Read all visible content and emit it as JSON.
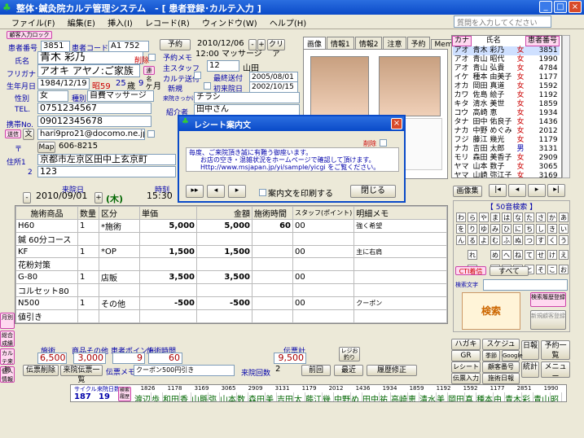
{
  "window": {
    "title": "整体･鍼灸院カルテ管理システム　- [ 患者登録･カルテ入力 ]"
  },
  "menu": [
    "ファイル(F)",
    "編集(E)",
    "挿入(I)",
    "レコード(R)",
    "ウィンドウ(W)",
    "ヘルプ(H)"
  ],
  "search": {
    "placeholder": "質問を入力してください"
  },
  "patient": {
    "badge": "顧客入力ロック",
    "number_label": "患者番号",
    "number": "3851",
    "code_label": "患者コード",
    "code": "A1 752",
    "reserve_btn": "予約",
    "date": "2010/12/06",
    "clear_btn": "クリア",
    "name_label": "氏名",
    "name": "青木 彩乃",
    "delete_label": "削除",
    "furigana_label": "フリガナ",
    "furigana": "アオキ アヤノ:ご家族",
    "link_btn": "連名",
    "birth_label": "生年月日",
    "birth": "1984/12/19",
    "era": "昭59",
    "age": "25",
    "age_unit": "歳",
    "months": "9",
    "months_unit": "ヶ月",
    "sex_label": "性別",
    "sex": "女",
    "type_label": "種別",
    "type": "自費マッサージ",
    "tel_label": "TEL.",
    "tel": "0751234567",
    "mobile_label": "携帯No.",
    "mobile": "09012345678",
    "mail_label": "文",
    "mail": "hari9pro21@docomo.ne.jp",
    "map_btn": "Map",
    "zip": "606-8215",
    "addr_label": "住所1",
    "addr1": "京都市左京区田中上玄京町",
    "addr2_label": "2",
    "addr2": "123",
    "memo_label": "予約メモ",
    "memo": "12:00 マッサージ",
    "staff_label": "主スタッフ",
    "staff_no": "12",
    "staff": "山田",
    "card_label": "カルテ送付",
    "last_visit_label": "最終送付",
    "last_visit": "2005/08/01",
    "new_label": "新規",
    "first_visit_label": "初来院日",
    "first_visit": "2002/10/15",
    "route_label": "来院きっかけ",
    "route": "チラシ",
    "intro_label": "紹介者",
    "intro": "田中さん"
  },
  "tabs": [
    "画像",
    "情報1",
    "情報2",
    "注意",
    "予約",
    "Memo"
  ],
  "patient_list": {
    "headers": [
      "カナ",
      "氏名",
      "",
      "患者番号"
    ],
    "rows": [
      [
        "アオ",
        "青木 彩乃",
        "女",
        "3851"
      ],
      [
        "アオ",
        "青山 昭代",
        "女",
        "1990"
      ],
      [
        "アオ",
        "青山 弘貴",
        "女",
        "4784"
      ],
      [
        "イケ",
        "種本 由美子",
        "女",
        "1177"
      ],
      [
        "オカ",
        "岡田 真道",
        "女",
        "1592"
      ],
      [
        "カワ",
        "佐島 絵子",
        "女",
        "1192"
      ],
      [
        "キタ",
        "清水 美世",
        "女",
        "1859"
      ],
      [
        "コウ",
        "高崎 恵",
        "女",
        "1934"
      ],
      [
        "タナ",
        "田中 佑良子",
        "女",
        "1436"
      ],
      [
        "ナカ",
        "中野 めぐみ",
        "女",
        "2012"
      ],
      [
        "フジ",
        "藤江 幾光",
        "女",
        "1179"
      ],
      [
        "ナカ",
        "吉田 太郎",
        "男",
        "3131"
      ],
      [
        "モリ",
        "森田 美香子",
        "女",
        "2909"
      ],
      [
        "ヤマ",
        "山本 数子",
        "女",
        "3065"
      ],
      [
        "ヤマ",
        "山崎 弥江子",
        "女",
        "3169"
      ],
      [
        "ワタ",
        "渡辺 みまる",
        "女",
        "1826"
      ]
    ]
  },
  "dialog": {
    "title": "レシート案内文",
    "delete_label": "削除",
    "line1": "毎度、ご来院頂き誠に有難う御座います。",
    "line2": "お店の空き・混雑状況をホームページで確認して頂けます。",
    "line3": "Http://www.msjapan.jp/yi/sample/yicgi  をご覧ください。",
    "print_label": "案内文を印刷する",
    "close_btn": "閉じる"
  },
  "visit": {
    "date_label": "来院日",
    "date": "2010/09/01",
    "weekday": "(木)",
    "time_label": "時刻",
    "time": "15:30",
    "headers": [
      "施術商品",
      "数量",
      "区分",
      "単価",
      "金額",
      "施術時間",
      "スタッフ(ポイント)",
      "明細メモ"
    ],
    "rows": [
      [
        "H60",
        "1",
        "*施術",
        "5,000",
        "5,000",
        "60",
        "00",
        "強く希望"
      ],
      [
        "鍼 60分コース",
        "",
        "",
        "",
        "",
        "",
        "",
        ""
      ],
      [
        "KF",
        "1",
        "*OP",
        "1,500",
        "1,500",
        "",
        "00",
        "主に右肩"
      ],
      [
        "花粉対策",
        "",
        "",
        "",
        "",
        "",
        "",
        ""
      ],
      [
        "G-80",
        "1",
        "店販",
        "3,500",
        "3,500",
        "",
        "00",
        ""
      ],
      [
        "コルセット80",
        "",
        "",
        "",
        "",
        "",
        "",
        ""
      ],
      [
        "N500",
        "1",
        "その他",
        "-500",
        "-500",
        "",
        "00",
        "クーポン"
      ],
      [
        "値引き",
        "",
        "",
        "",
        "",
        "",
        "",
        ""
      ]
    ]
  },
  "totals": {
    "labels": [
      "施術",
      "商品その他",
      "患者ポイント",
      "施術時間"
    ],
    "values": [
      "6,500",
      "3,000",
      "9",
      "60"
    ],
    "receipt_label": "伝票計",
    "receipt": "9,500",
    "count_label": "来院回数",
    "count": "2",
    "prev": "前回",
    "latest": "最近",
    "history": "履歴修正",
    "delete_btn": "伝票削除",
    "list_btn": "来院伝票一覧",
    "memo_label": "伝票メモ",
    "memo": "クーポン500円引き",
    "reg_btn": "レジお釣り"
  },
  "kana_panel": {
    "title": "【 50音検索 】",
    "kana": [
      "わ",
      "ら",
      "や",
      "ま",
      "は",
      "な",
      "た",
      "さ",
      "か",
      "あ",
      "を",
      "り",
      "ゆ",
      "み",
      "ひ",
      "に",
      "ち",
      "し",
      "き",
      "い",
      "ん",
      "る",
      "よ",
      "む",
      "ふ",
      "ぬ",
      "つ",
      "す",
      "く",
      "う",
      "",
      "れ",
      "",
      "め",
      "へ",
      "ね",
      "て",
      "せ",
      "け",
      "え",
      "",
      "ろ",
      "",
      "も",
      "ほ",
      "の",
      "と",
      "そ",
      "こ",
      "お"
    ],
    "cti": "CTI着信",
    "all": "すべて",
    "search_label": "検索文字",
    "search_btn": "検索",
    "detail_btn": "検索履歴登録",
    "new_btn": "新規顧客登録"
  },
  "right_buttons": [
    "ハガキ",
    "スケジュール",
    "日報",
    "予約一覧",
    "GR",
    "季節",
    "Google",
    "統計",
    "メニュー",
    "レシート",
    "顧客番号",
    "伝票入力",
    "施術日報"
  ],
  "image_btn": "画像集",
  "left_tabs": [
    "月別",
    "総合成績",
    "カルテ来院",
    "個人情報"
  ],
  "bottom": {
    "cycle_label": "サイクル",
    "interval_label": "来院日数",
    "cycle": "187",
    "interval": "19",
    "btn": "検索履歴",
    "nums": [
      "1826",
      "1178",
      "3169",
      "3065",
      "2909",
      "3131",
      "1179",
      "2012",
      "1436",
      "1934",
      "1859",
      "1192",
      "1592",
      "1177",
      "2851",
      "1990"
    ],
    "names": [
      "渡辺",
      "歩",
      "和田",
      "香",
      "山縣",
      "弥",
      "山本",
      "数",
      "森田",
      "美",
      "吉田",
      "太",
      "藤江",
      "幾",
      "中野",
      "め",
      "田中",
      "祐",
      "高崎",
      "恵",
      "清水",
      "美",
      "岡田",
      "真",
      "種本",
      "由",
      "青木",
      "彩",
      "青山",
      "昭"
    ]
  }
}
